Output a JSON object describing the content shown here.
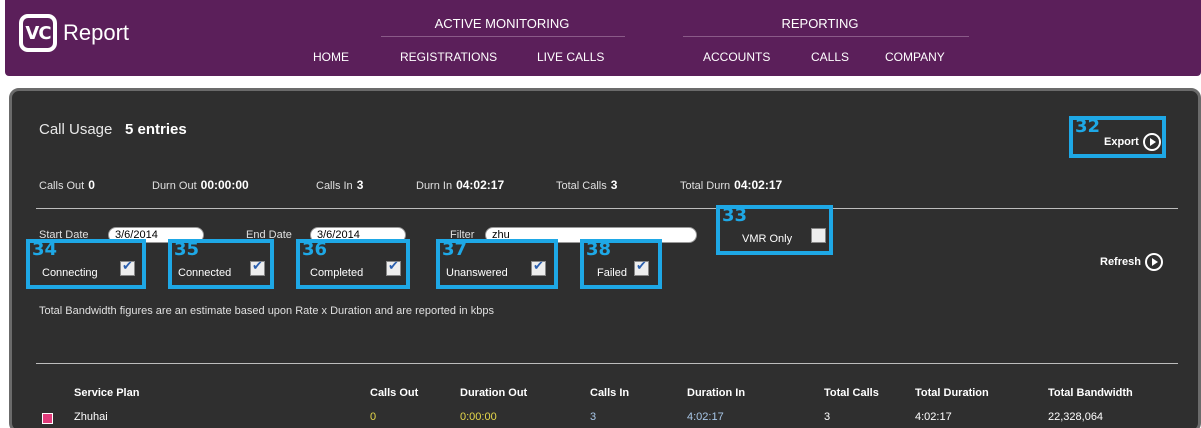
{
  "header": {
    "logo_mark": "VC",
    "logo_text": "Report",
    "groups": {
      "active_monitoring": "ACTIVE MONITORING",
      "reporting": "REPORTING"
    },
    "nav": {
      "home": "HOME",
      "registrations": "REGISTRATIONS",
      "live_calls": "LIVE CALLS",
      "accounts": "ACCOUNTS",
      "calls": "CALLS",
      "company": "COMPANY"
    }
  },
  "panel": {
    "title": "Call Usage",
    "entries": "5 entries",
    "export_num": "32",
    "export_label": "Export",
    "refresh_label": "Refresh",
    "stats": {
      "calls_out_label": "Calls Out",
      "calls_out": "0",
      "durn_out_label": "Durn Out",
      "durn_out": "00:00:00",
      "calls_in_label": "Calls In",
      "calls_in": "3",
      "durn_in_label": "Durn In",
      "durn_in": "04:02:17",
      "total_calls_label": "Total Calls",
      "total_calls": "3",
      "total_durn_label": "Total Durn",
      "total_durn": "04:02:17"
    },
    "filters": {
      "start_date_label": "Start Date",
      "start_date": "3/6/2014",
      "end_date_label": "End Date",
      "end_date": "3/6/2014",
      "filter_label": "Filter",
      "filter_value": "zhu"
    },
    "checkboxes": {
      "vmr_only": {
        "num": "33",
        "label": "VMR Only",
        "checked": false
      },
      "connecting": {
        "num": "34",
        "label": "Connecting",
        "checked": true
      },
      "connected": {
        "num": "35",
        "label": "Connected",
        "checked": true
      },
      "completed": {
        "num": "36",
        "label": "Completed",
        "checked": true
      },
      "unanswered": {
        "num": "37",
        "label": "Unanswered",
        "checked": true
      },
      "failed": {
        "num": "38",
        "label": "Failed",
        "checked": true
      }
    },
    "note": "Total Bandwidth figures are an estimate based upon Rate x Duration and are reported in kbps",
    "table": {
      "headers": [
        "Service Plan",
        "Calls Out",
        "Duration Out",
        "Calls In",
        "Duration In",
        "Total Calls",
        "Total Duration",
        "Total Bandwidth"
      ],
      "rows": [
        [
          "Zhuhai",
          "0",
          "0:00:00",
          "3",
          "4:02:17",
          "3",
          "4:02:17",
          "22,328,064"
        ]
      ]
    }
  },
  "colors": {
    "header_bg": "#5b1f5a",
    "panel_bg": "#2f2f2f",
    "annotation": "#1ea8e6",
    "out_values": "#e6d94a",
    "in_values": "#a8c7e8"
  }
}
